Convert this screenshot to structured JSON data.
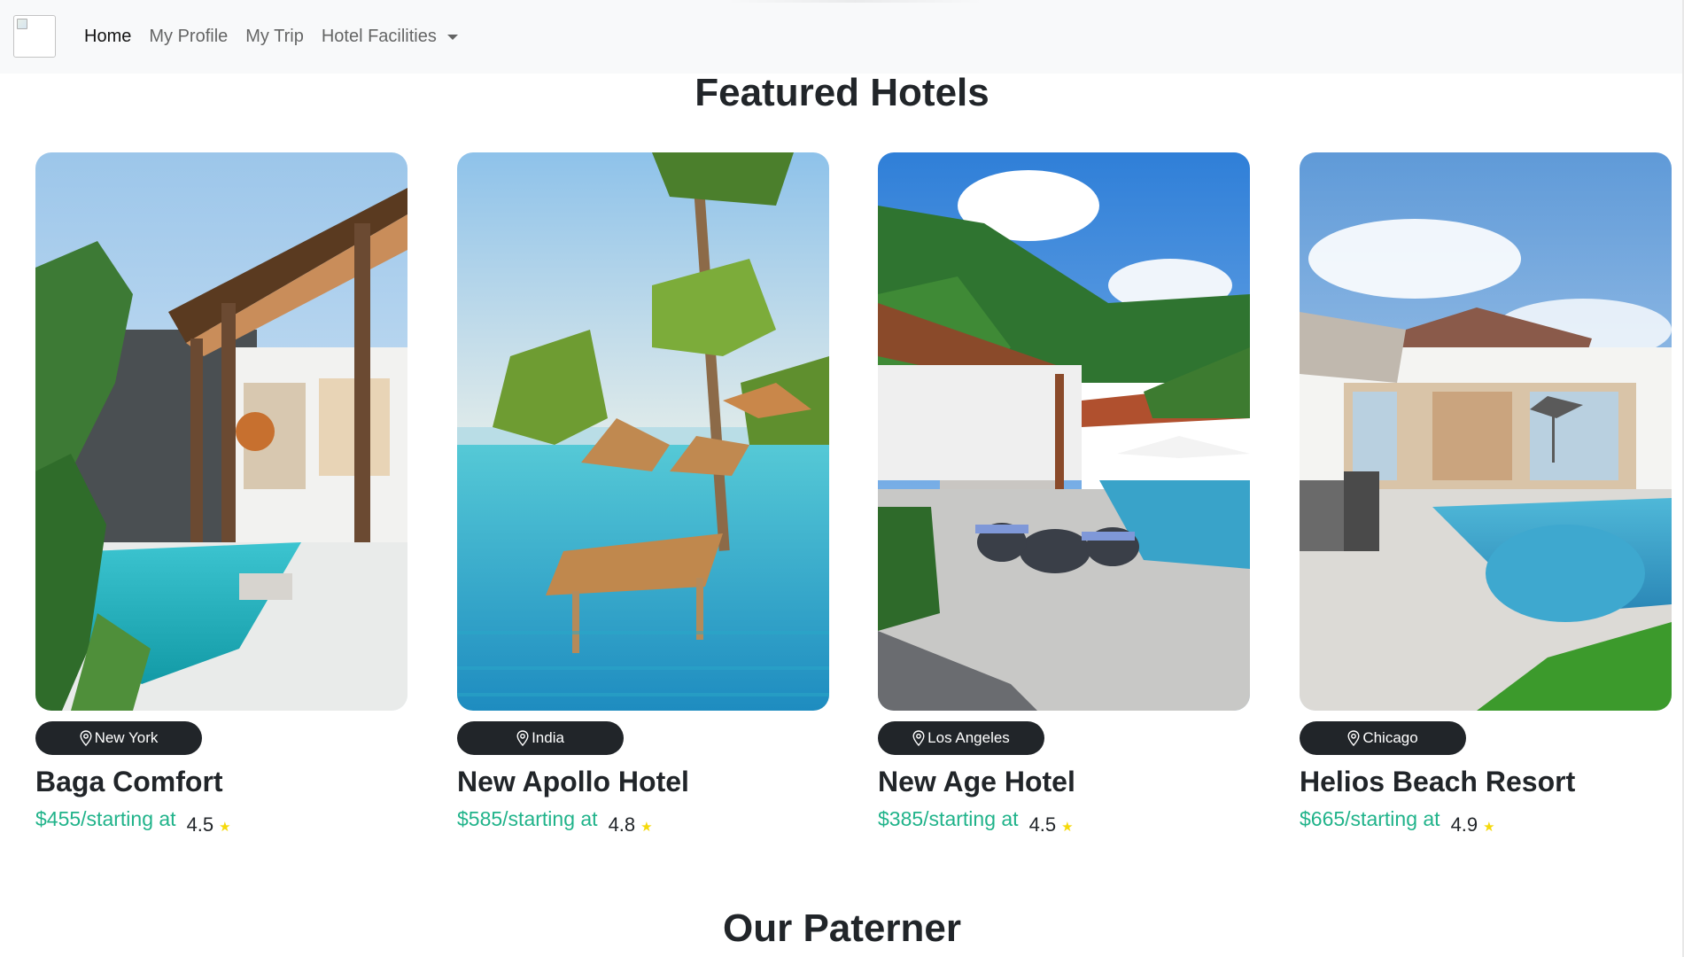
{
  "nav": {
    "items": [
      {
        "label": "Home",
        "active": true
      },
      {
        "label": "My Profile",
        "active": false
      },
      {
        "label": "My Trip",
        "active": false
      },
      {
        "label": "Hotel Facilities",
        "active": false,
        "dropdown": true
      }
    ]
  },
  "featured": {
    "title": "Featured Hotels",
    "hotels": [
      {
        "location": "New York",
        "name": "Baga Comfort",
        "price": "$455/starting at",
        "rating": "4.5",
        "star": "★"
      },
      {
        "location": "India",
        "name": "New Apollo Hotel",
        "price": "$585/starting at",
        "rating": "4.8",
        "star": "★"
      },
      {
        "location": "Los Angeles",
        "name": "New Age Hotel",
        "price": "$385/starting at",
        "rating": "4.5",
        "star": "★"
      },
      {
        "location": "Chicago",
        "name": "Helios Beach Resort",
        "price": "$665/starting at",
        "rating": "4.9",
        "star": "★"
      }
    ]
  },
  "partner": {
    "title": "Our Paterner"
  },
  "colors": {
    "navbar_bg": "#f8f9fa",
    "pill_bg": "#212529",
    "price": "#20b38a",
    "star": "#f5d90a"
  },
  "icons": {
    "location": "map-pin-icon",
    "rating": "star-icon",
    "dropdown": "caret-down-icon"
  }
}
